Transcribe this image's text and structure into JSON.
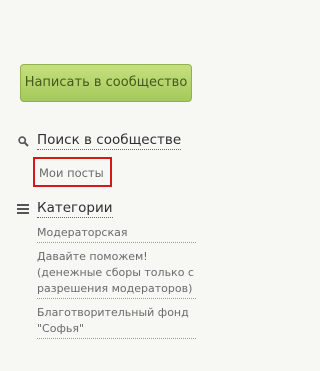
{
  "actions": {
    "write_label": "Написать в сообщество"
  },
  "search": {
    "title": "Поиск в сообществе",
    "icon": "search-icon",
    "items": [
      {
        "label": "Мои посты",
        "highlighted": true,
        "highlight_color": "#d81818"
      }
    ]
  },
  "categories": {
    "title": "Категории",
    "icon": "list-icon",
    "items": [
      {
        "label": "Модераторская"
      },
      {
        "label": "Давайте поможем! (денежные сборы только с разрешения модераторов)"
      },
      {
        "label": "Благотворительный фонд \"Софья\""
      }
    ]
  },
  "colors": {
    "button_green": "#b3d46b",
    "button_text": "#3f5c1c",
    "highlight": "#d81818"
  }
}
